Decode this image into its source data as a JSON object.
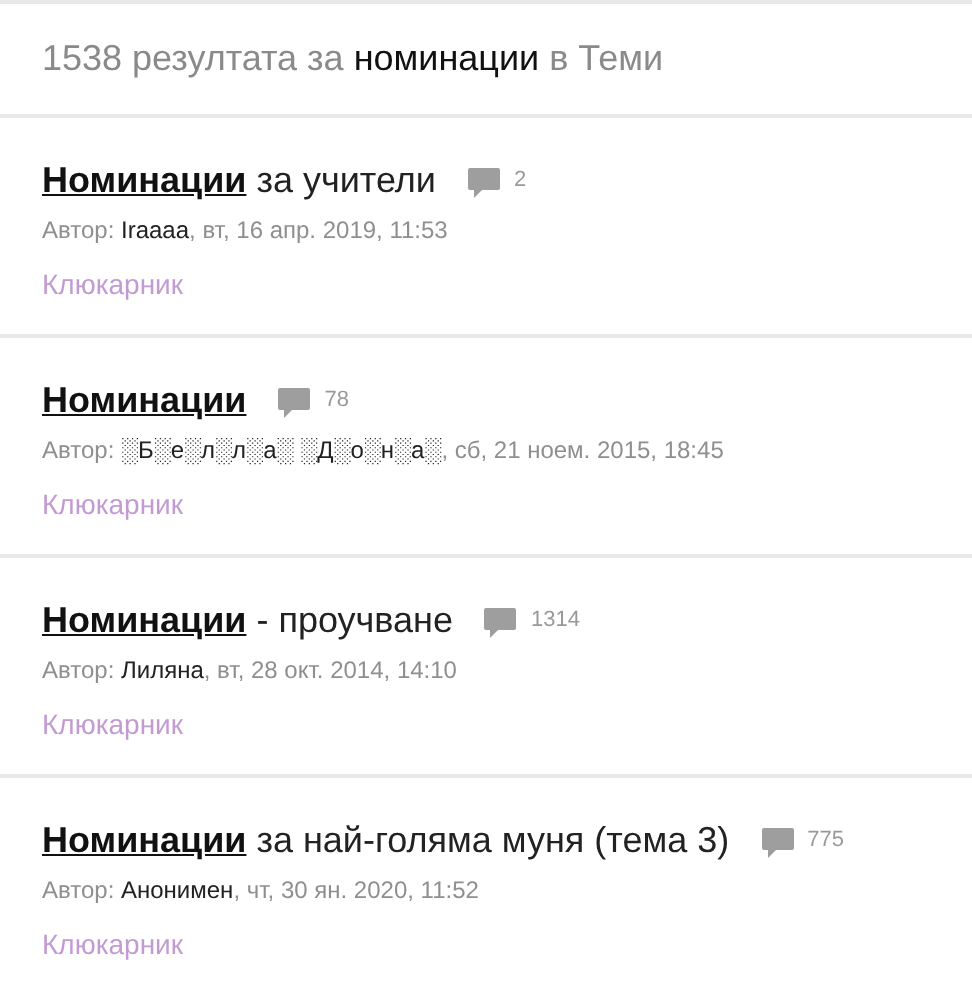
{
  "results_heading": {
    "prefix": "1538 резултата за",
    "query": "номинации",
    "suffix": "в Теми"
  },
  "results": [
    {
      "title_link": "Номинации",
      "title_rest": "за учители",
      "comments": "2",
      "author_label": "Автор:",
      "author": "Iraaaa",
      "date": ", вт, 16 апр. 2019, 11:53",
      "category": "Клюкарник"
    },
    {
      "title_link": "Номинации",
      "comments": "78",
      "author_label": "Автор:",
      "author": "░Б░е░л░л░а░ ░Д░о░н░а░",
      "date": ", сб, 21 ноем. 2015, 18:45",
      "category": "Клюкарник"
    },
    {
      "title_link": "Номинации",
      "title_rest": "- проучване",
      "comments": "1314",
      "author_label": "Автор:",
      "author": "Лиляна",
      "date": ", вт, 28 окт. 2014, 14:10",
      "category": "Клюкарник"
    },
    {
      "title_link": "Номинации",
      "title_rest": "за най-голяма муня (тема 3)",
      "comments": "775",
      "author_label": "Автор:",
      "author": "Анонимен",
      "date": ", чт, 30 ян. 2020, 11:52",
      "category": "Клюкарник"
    }
  ]
}
